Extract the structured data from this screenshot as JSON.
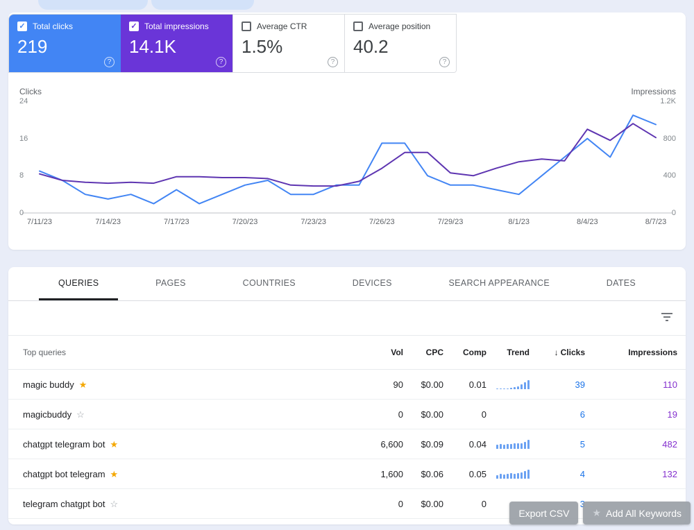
{
  "icons": {
    "check": "✓",
    "help": "?",
    "sort_desc": "↓",
    "star_filled": "★",
    "star_outline": "☆"
  },
  "metric_cards": [
    {
      "label": "Total clicks",
      "value": "219",
      "selected": true,
      "color": "#4285f4"
    },
    {
      "label": "Total impressions",
      "value": "14.1K",
      "selected": true,
      "color": "#6a35d8"
    },
    {
      "label": "Average CTR",
      "value": "1.5%",
      "selected": false,
      "color": ""
    },
    {
      "label": "Average position",
      "value": "40.2",
      "selected": false,
      "color": ""
    }
  ],
  "chart_data": {
    "type": "line",
    "x_tick_labels": [
      "7/11/23",
      "7/14/23",
      "7/17/23",
      "7/20/23",
      "7/23/23",
      "7/26/23",
      "7/29/23",
      "8/1/23",
      "8/4/23",
      "8/7/23"
    ],
    "x_tick_day_step": 3,
    "left_axis": {
      "label": "Clicks",
      "ticks": [
        "24",
        "16",
        "8",
        "0"
      ],
      "tick_values": [
        24,
        16,
        8,
        0
      ],
      "max": 24
    },
    "right_axis": {
      "label": "Impressions",
      "ticks": [
        "1.2K",
        "800",
        "400",
        "0"
      ],
      "tick_values": [
        1200,
        800,
        400,
        0
      ],
      "max": 1200
    },
    "series": [
      {
        "name": "Clicks",
        "axis": "left",
        "color": "#4285f4",
        "values": [
          9,
          7,
          4,
          3,
          4,
          2,
          5,
          2,
          4,
          6,
          7,
          4,
          4,
          6,
          6,
          15,
          15,
          8,
          6,
          6,
          5,
          4,
          8,
          12,
          16,
          12,
          21,
          19
        ]
      },
      {
        "name": "Impressions",
        "axis": "right",
        "color": "#5e35b1",
        "values": [
          420,
          350,
          330,
          320,
          330,
          320,
          390,
          390,
          380,
          380,
          370,
          300,
          290,
          290,
          340,
          480,
          650,
          650,
          430,
          400,
          480,
          550,
          580,
          560,
          900,
          780,
          960,
          810
        ]
      }
    ],
    "grid": "baseline-only",
    "legend_position": "none"
  },
  "tabs": [
    {
      "label": "QUERIES",
      "active": true
    },
    {
      "label": "PAGES",
      "active": false
    },
    {
      "label": "COUNTRIES",
      "active": false
    },
    {
      "label": "DEVICES",
      "active": false
    },
    {
      "label": "SEARCH APPEARANCE",
      "active": false
    },
    {
      "label": "DATES",
      "active": false
    }
  ],
  "table": {
    "title_col": "Top queries",
    "columns": [
      "Vol",
      "CPC",
      "Comp",
      "Trend",
      "Clicks",
      "Impressions"
    ],
    "sort_column": "Clicks",
    "sort_direction": "desc",
    "rows": [
      {
        "query": "magic buddy",
        "starred": true,
        "vol": "90",
        "cpc": "$0.00",
        "comp": "0.01",
        "trend": [
          0.08,
          0.08,
          0.08,
          0.1,
          0.15,
          0.2,
          0.3,
          0.5,
          0.75,
          1
        ],
        "clicks": "39",
        "impressions": "110"
      },
      {
        "query": "magicbuddy",
        "starred": false,
        "vol": "0",
        "cpc": "$0.00",
        "comp": "0",
        "trend": [],
        "clicks": "6",
        "impressions": "19"
      },
      {
        "query": "chatgpt telegram bot",
        "starred": true,
        "vol": "6,600",
        "cpc": "$0.09",
        "comp": "0.04",
        "trend": [
          0.45,
          0.5,
          0.48,
          0.55,
          0.5,
          0.58,
          0.6,
          0.65,
          0.8,
          1
        ],
        "clicks": "5",
        "impressions": "482"
      },
      {
        "query": "chatgpt bot telegram",
        "starred": true,
        "vol": "1,600",
        "cpc": "$0.06",
        "comp": "0.05",
        "trend": [
          0.4,
          0.5,
          0.45,
          0.55,
          0.6,
          0.55,
          0.65,
          0.7,
          0.85,
          1
        ],
        "clicks": "4",
        "impressions": "132"
      },
      {
        "query": "telegram chatgpt bot",
        "starred": false,
        "vol": "0",
        "cpc": "$0.00",
        "comp": "0",
        "trend": [],
        "clicks": "3",
        "impressions": ""
      }
    ]
  },
  "overlay_buttons": {
    "export": "Export CSV",
    "add_all": "Add All Keywords"
  },
  "colors": {
    "clicks_accent": "#4285f4",
    "impressions_accent": "#6a35d8",
    "clicks_text": "#1a73e8",
    "impressions_text": "#8430ce",
    "page_background": "#e9edf8"
  }
}
